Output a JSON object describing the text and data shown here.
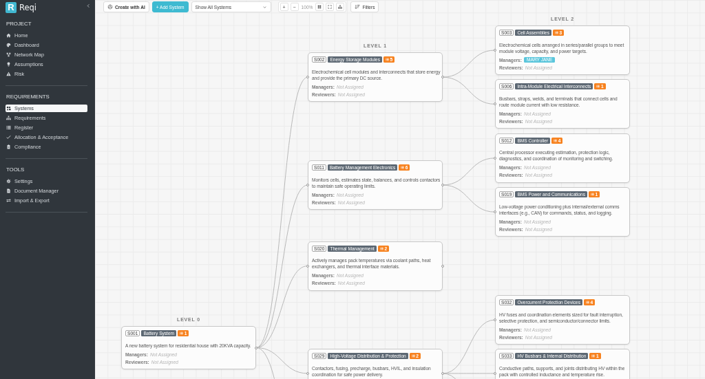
{
  "sidebar": {
    "logo": "R",
    "brand": "Reqi",
    "sections": [
      {
        "title": "PROJECT",
        "items": [
          {
            "label": "Home",
            "selected": false
          },
          {
            "label": "Dashboard",
            "selected": false
          },
          {
            "label": "Network Map",
            "selected": false
          },
          {
            "label": "Assumptions",
            "selected": false
          },
          {
            "label": "Risk",
            "selected": false
          }
        ]
      },
      {
        "title": "REQUIREMENTS",
        "items": [
          {
            "label": "Systems",
            "selected": true
          },
          {
            "label": "Requirements",
            "selected": false
          },
          {
            "label": "Register",
            "selected": false
          },
          {
            "label": "Allocation & Acceptance",
            "selected": false
          },
          {
            "label": "Compliance",
            "selected": false
          }
        ]
      },
      {
        "title": "TOOLS",
        "items": [
          {
            "label": "Settings",
            "selected": false
          },
          {
            "label": "Document Manager",
            "selected": false
          },
          {
            "label": "Import & Export",
            "selected": false
          }
        ]
      }
    ]
  },
  "toolbar": {
    "create_button": "Create with AI",
    "add_button": "+ Add System",
    "system_filter": {
      "value": "Show All Systems"
    },
    "zoom_in": "+",
    "zoom_out": "−",
    "zoom_level": "100%",
    "filters_button": "Filters"
  },
  "canvas": {
    "levels": [
      "LEVEL 0",
      "LEVEL 1",
      "LEVEL 2"
    ],
    "tree": {
      "kind": "node",
      "id": "S001",
      "name": "Battery System",
      "count": "1",
      "description": "A new battery system for residential house with 20KVA capacity.",
      "fields": [
        {
          "label": "Managers:",
          "kind": "unassigned",
          "value": "Not Assigned"
        },
        {
          "label": "Reviewers:",
          "kind": "unassigned",
          "value": "Not Assigned"
        }
      ],
      "children": [
        {
          "kind": "node",
          "id": "S002",
          "name": "Energy Storage Modules",
          "count": "5",
          "description": "Electrochemical cell modules and interconnects that store energy and provide the primary DC source.",
          "fields": [
            {
              "label": "Managers:",
              "kind": "unassigned",
              "value": "Not Assigned"
            },
            {
              "label": "Reviewers:",
              "kind": "unassigned",
              "value": "Not Assigned"
            }
          ],
          "children": [
            {
              "kind": "node",
              "id": "S003",
              "name": "Cell Assemblies",
              "count": "3",
              "description": "Electrochemical cells arranged in series/parallel groups to meet module voltage, capacity, and power targets.",
              "fields": [
                {
                  "label": "Managers:",
                  "kind": "person",
                  "value": "MARY JANE"
                },
                {
                  "label": "Reviewers:",
                  "kind": "unassigned",
                  "value": "Not Assigned"
                }
              ]
            },
            {
              "kind": "node",
              "id": "S006",
              "name": "Intra-Module Electrical Interconnects",
              "count": "1",
              "description": "Busbars, straps, welds, and terminals that connect cells and route module current with low resistance.",
              "fields": [
                {
                  "label": "Managers:",
                  "kind": "unassigned",
                  "value": "Not Assigned"
                },
                {
                  "label": "Reviewers:",
                  "kind": "unassigned",
                  "value": "Not Assigned"
                }
              ]
            }
          ]
        },
        {
          "kind": "node",
          "id": "S011",
          "name": "Battery Management Electronics",
          "count": "6",
          "description": "Monitors cells, estimates state, balances, and controls contactors to maintain safe operating limits.",
          "fields": [
            {
              "label": "Managers:",
              "kind": "unassigned",
              "value": "Not Assigned"
            },
            {
              "label": "Reviewers:",
              "kind": "unassigned",
              "value": "Not Assigned"
            }
          ],
          "children": [
            {
              "kind": "node",
              "id": "S012",
              "name": "BMS Controller",
              "count": "4",
              "description": "Central processor executing estimation, protection logic, diagnostics, and coordination of monitoring and switching.",
              "fields": [
                {
                  "label": "Managers:",
                  "kind": "unassigned",
                  "value": "Not Assigned"
                },
                {
                  "label": "Reviewers:",
                  "kind": "unassigned",
                  "value": "Not Assigned"
                }
              ]
            },
            {
              "kind": "node",
              "id": "S019",
              "name": "BMS Power and Communications",
              "count": "1",
              "description": "Low-voltage power conditioning plus internal/external comms interfaces (e.g., CAN) for commands, status, and logging.",
              "fields": [
                {
                  "label": "Managers:",
                  "kind": "unassigned",
                  "value": "Not Assigned"
                },
                {
                  "label": "Reviewers:",
                  "kind": "unassigned",
                  "value": "Not Assigned"
                }
              ]
            }
          ]
        },
        {
          "kind": "node",
          "id": "S020",
          "name": "Thermal Management",
          "count": "2",
          "description": "Actively manages pack temperatures via coolant paths, heat exchangers, and thermal interface materials.",
          "fields": [
            {
              "label": "Managers:",
              "kind": "unassigned",
              "value": "Not Assigned"
            },
            {
              "label": "Reviewers:",
              "kind": "unassigned",
              "value": "Not Assigned"
            }
          ]
        },
        {
          "kind": "node",
          "id": "S029",
          "name": "High-Voltage Distribution & Protection",
          "count": "2",
          "description": "Contactors, fusing, precharge, busbars, HVIL, and insulation coordination for safe power delivery.",
          "children": [
            {
              "kind": "node",
              "id": "S032",
              "name": "Overcurrent Protection Devices",
              "count": "4",
              "description": "HV fuses and coordination elements sized for fault interruption, selective protection, and semiconductor/connector limits.",
              "fields": [
                {
                  "label": "Managers:",
                  "kind": "unassigned",
                  "value": "Not Assigned"
                },
                {
                  "label": "Reviewers:",
                  "kind": "unassigned",
                  "value": "Not Assigned"
                }
              ]
            },
            {
              "kind": "node",
              "id": "S033",
              "name": "HV Busbars & Internal Distribution",
              "count": "1",
              "description": "Conductive paths, supports, and joints distributing HV within the pack with controlled inductance and temperature rise."
            },
            {
              "kind": "offscreen"
            }
          ]
        },
        {
          "kind": "offscreen"
        }
      ]
    }
  }
}
